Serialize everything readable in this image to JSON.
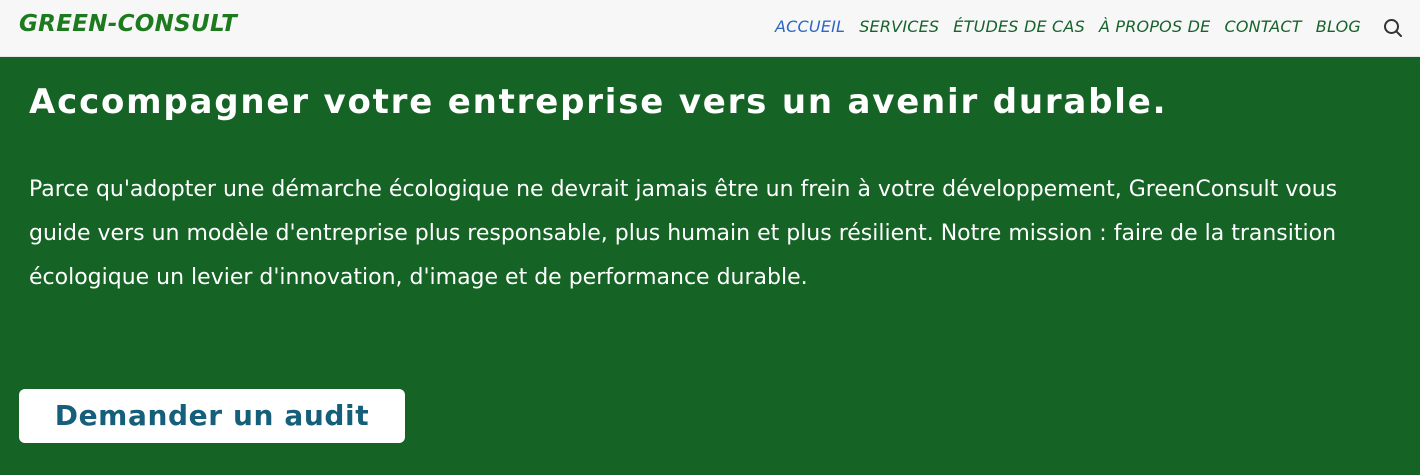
{
  "header": {
    "logo": "GREEN-CONSULT",
    "nav": [
      {
        "label": "ACCUEIL",
        "active": true
      },
      {
        "label": "SERVICES",
        "active": false
      },
      {
        "label": "ÉTUDES DE CAS",
        "active": false
      },
      {
        "label": "À PROPOS DE",
        "active": false
      },
      {
        "label": "CONTACT",
        "active": false
      },
      {
        "label": "BLOG",
        "active": false
      }
    ],
    "search_icon": "search-icon"
  },
  "hero": {
    "title": "Accompagner votre entreprise vers un avenir durable.",
    "text": "Parce qu'adopter une démarche écologique ne devrait jamais être un frein à votre développement, GreenConsult vous guide vers un modèle d'entreprise plus responsable, plus humain et plus résilient. Notre mission : faire de la transition écologique un levier d'innovation, d'image et de performance durable.",
    "cta_label": "Demander un audit"
  },
  "colors": {
    "hero_background": "#156325",
    "header_background": "#f7f7f7",
    "logo": "#1e7a1e",
    "nav_link": "#17632c",
    "nav_active": "#2d67c3",
    "cta_text": "#155f7a"
  }
}
